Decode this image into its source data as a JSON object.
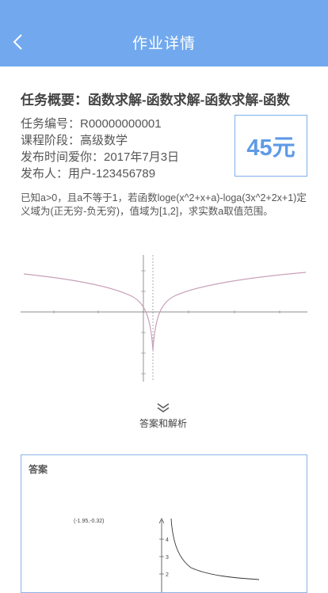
{
  "header": {
    "title": "作业详情",
    "back_icon": "chevron-left-icon"
  },
  "task": {
    "title": "任务概要：函数求解-函数求解-函数求解-函数",
    "number": "任务编号：R00000000001",
    "stage": "课程阶段：高级数学",
    "publish_time": "发布时间爱你：2017年7月3日",
    "publisher": "发布人：用户-123456789",
    "price": "45元",
    "question": "已知a>0，且a不等于1，若函数loge(x^2+x+a)-loga(3x^2+2x+1)定义域为(正无穷-负无穷)，值域为[1,2]，求实数a取值范围。"
  },
  "toggle": {
    "label": "答案和解析",
    "icon": "double-chevron-down-icon"
  },
  "answer": {
    "heading": "答案",
    "point_label": "(-1.95,-0.32)",
    "y_ticks": [
      "4",
      "3",
      "2"
    ]
  },
  "colors": {
    "nav_bg": "#72a9ee",
    "accent": "#5f9ae6",
    "curve": "#c9a0b8"
  }
}
